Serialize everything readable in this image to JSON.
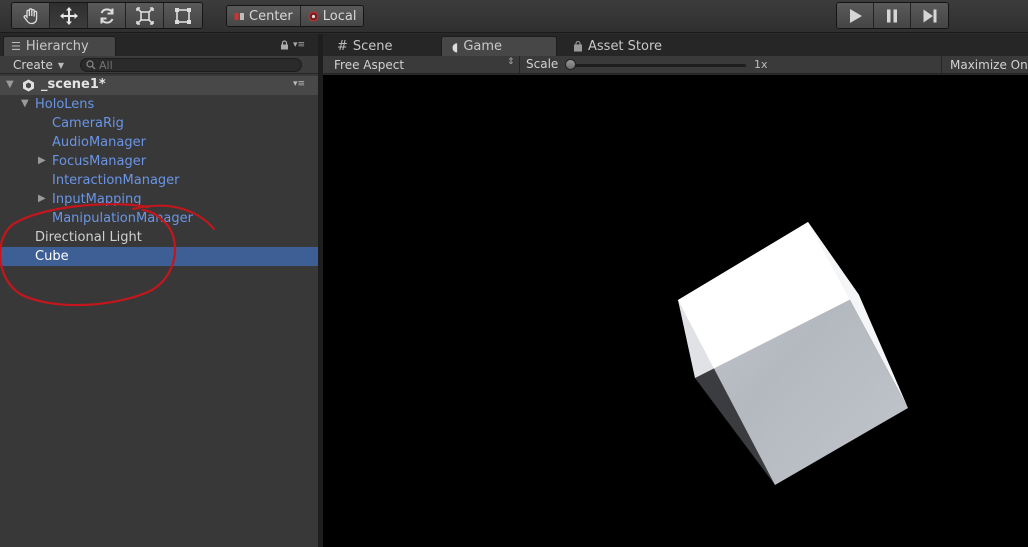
{
  "toolbar": {
    "pivot_center": "Center",
    "pivot_local": "Local"
  },
  "hierarchy": {
    "tab_label": "Hierarchy",
    "create_label": "Create",
    "search_placeholder": "All",
    "scene_name": "_scene1*",
    "items": [
      {
        "label": "HoloLens",
        "depth": 0
      },
      {
        "label": "CameraRig",
        "depth": 1
      },
      {
        "label": "AudioManager",
        "depth": 1
      },
      {
        "label": "FocusManager",
        "depth": 1
      },
      {
        "label": "InteractionManager",
        "depth": 1
      },
      {
        "label": "InputMapping",
        "depth": 1
      },
      {
        "label": "ManipulationManager",
        "depth": 1
      },
      {
        "label": "Directional Light",
        "depth": 0
      },
      {
        "label": "Cube",
        "depth": 0
      }
    ]
  },
  "tabs": {
    "scene": "Scene",
    "game": "Game",
    "asset_store": "Asset Store"
  },
  "game_view": {
    "aspect": "Free Aspect",
    "scale_label": "Scale",
    "scale_value": "1x",
    "maximize": "Maximize On Play"
  },
  "colors": {
    "selection": "#3e5f96",
    "prefab_text": "#6a95e6",
    "annotation": "#c4161c"
  }
}
